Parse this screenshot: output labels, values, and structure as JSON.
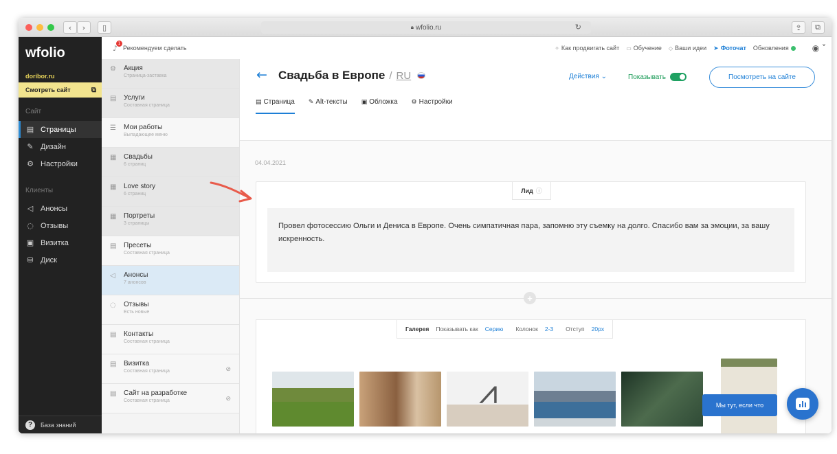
{
  "browser": {
    "url": "wfolio.ru"
  },
  "brand": {
    "logo": "wfolio",
    "domain": "doribor.ru",
    "view_site": "Смотреть сайт"
  },
  "sidebar": {
    "site_header": "Сайт",
    "site_items": [
      {
        "label": "Страницы",
        "icon": "page-icon"
      },
      {
        "label": "Дизайн",
        "icon": "brush-icon"
      },
      {
        "label": "Настройки",
        "icon": "gear-icon"
      }
    ],
    "clients_header": "Клиенты",
    "client_items": [
      {
        "label": "Анонсы",
        "icon": "megaphone-icon"
      },
      {
        "label": "Отзывы",
        "icon": "chat-icon"
      },
      {
        "label": "Визитка",
        "icon": "card-icon"
      },
      {
        "label": "Диск",
        "icon": "disk-icon"
      }
    ],
    "knowledge_base": "База знаний"
  },
  "topbar": {
    "recommend": "Рекомендуем сделать",
    "recommend_count": "1",
    "links": [
      "Как продвигать сайт",
      "Обучение",
      "Ваши идеи",
      "Фоточат",
      "Обновления"
    ]
  },
  "pages": [
    {
      "title": "Акция",
      "sub": "Страница-заставка"
    },
    {
      "title": "Услуги",
      "sub": "Составная страница"
    },
    {
      "title": "Мои работы",
      "sub": "Выпадающее меню"
    },
    {
      "title": "Свадьбы",
      "sub": "6 страниц"
    },
    {
      "title": "Love story",
      "sub": "6 страниц"
    },
    {
      "title": "Портреты",
      "sub": "3 страницы"
    },
    {
      "title": "Пресеты",
      "sub": "Составная страница"
    },
    {
      "title": "Анонсы",
      "sub": "7 анонсов"
    },
    {
      "title": "Отзывы",
      "sub": "Есть новые"
    },
    {
      "title": "Контакты",
      "sub": "Составная страница"
    },
    {
      "title": "Визитка",
      "sub": "Составная страница"
    },
    {
      "title": "Сайт на разработке",
      "sub": "Составная страница"
    }
  ],
  "page": {
    "title": "Свадьба в Европе",
    "lang_sep": "/",
    "lang": "RU",
    "actions": "Действия ⌄",
    "show": "Показывать",
    "show_enabled": true,
    "view_button": "Посмотреть на сайте",
    "tabs": [
      "Страница",
      "Alt-тексты",
      "Обложка",
      "Настройки"
    ],
    "date": "04.04.2021",
    "lead_label": "Лид",
    "lead_text": "Провел фотосессию Ольги и Дениса в Европе. Очень симпатичная пара, запомню эту съемку на долго. Спасибо вам за эмоции, за вашу искренность."
  },
  "gallery": {
    "label": "Галерея",
    "show_as_label": "Показывать как",
    "show_as_value": "Серию",
    "columns_label": "Колонок",
    "columns_value": "2-3",
    "gap_label": "Отступ",
    "gap_value": "20px"
  },
  "chat": {
    "bubble": "Мы тут, если что"
  }
}
